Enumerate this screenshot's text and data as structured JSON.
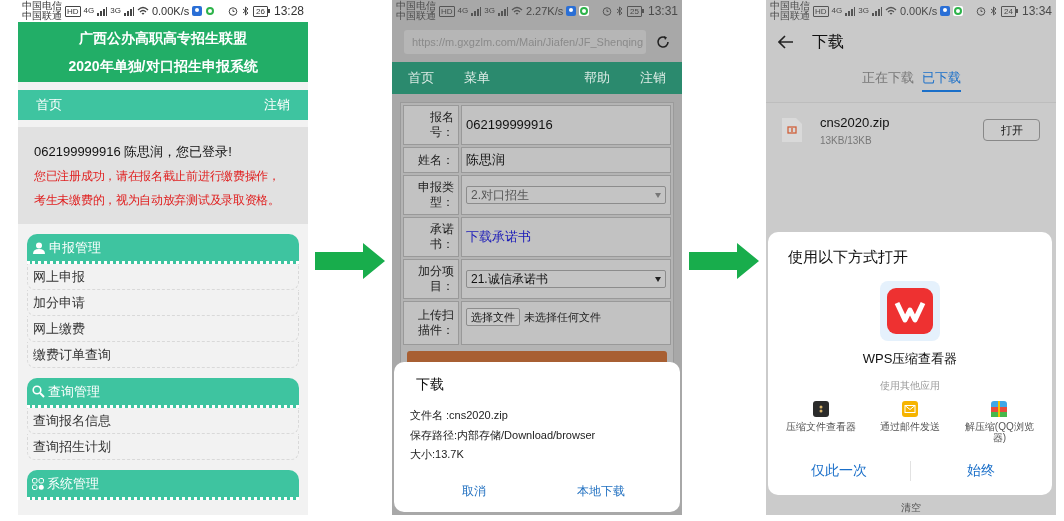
{
  "screen_1": {
    "status_bar": {
      "carrier_1": "中国电信",
      "carrier_2": "中国联通",
      "hd": "HD",
      "network_1": "4G",
      "network_2": "3G",
      "speed": "0.00K/s",
      "battery": "26",
      "time": "13:28"
    },
    "header": [
      "广西公办高职高专招生联盟",
      "2020年单独/对口招生申报系统"
    ],
    "nav": [
      "首页",
      "注销"
    ],
    "login": "062199999916 陈思润，您已登录!",
    "warning": [
      "您已注册成功，请在报名截止前进行缴费操作，",
      "考生未缴费的，视为自动放弃测试及录取资格。"
    ],
    "sections": [
      {
        "title": "申报管理",
        "items": [
          "网上申报",
          "加分申请",
          "网上缴费",
          "缴费订单查询"
        ]
      },
      {
        "title": "查询管理",
        "items": [
          "查询报名信息",
          "查询招生计划"
        ]
      },
      {
        "title": "系统管理"
      }
    ]
  },
  "screen_2": {
    "status_bar": {
      "carrier_1": "中国电信",
      "carrier_2": "中国联通",
      "hd": "HD",
      "network_1": "4G",
      "network_2": "3G",
      "speed": "2.27K/s",
      "battery": "25",
      "time": "13:31"
    },
    "url": "https://m.gxgzlm.com/Main/Jiafen/JF_Shenqing",
    "nav": [
      "首页",
      "菜单",
      "帮助",
      "注销"
    ],
    "form": [
      {
        "kind": "text",
        "label": "报名号：",
        "value": "062199999916"
      },
      {
        "kind": "text",
        "label": "姓名：",
        "value": "陈思润"
      },
      {
        "kind": "select",
        "label": "申报类型：",
        "value": "2.对口招生",
        "disabled": true
      },
      {
        "kind": "link",
        "label": "承诺书：",
        "value": "下载承诺书"
      },
      {
        "kind": "select",
        "label": "加分项目：",
        "value": "21.诚信承诺书",
        "disabled": false
      },
      {
        "kind": "file",
        "label": "上传扫描件：",
        "button": "选择文件",
        "value": "未选择任何文件"
      }
    ],
    "dialog": {
      "title": "下载",
      "lines": [
        "文件名 :cns2020.zip",
        "保存路径:内部存储/Download/browser",
        "大小:13.7K"
      ],
      "buttons": [
        "取消",
        "本地下载"
      ]
    }
  },
  "screen_3": {
    "status_bar": {
      "carrier_1": "中国电信",
      "carrier_2": "中国联通",
      "hd": "HD",
      "network_1": "4G",
      "network_2": "3G",
      "speed": "0.00K/s",
      "battery": "24",
      "time": "13:34"
    },
    "title": "下载",
    "tabs": [
      {
        "label": "正在下载",
        "selected": false
      },
      {
        "label": "已下载",
        "selected": true
      }
    ],
    "file": {
      "name": "cns2020.zip",
      "size": "13KB/13KB",
      "button": "打开"
    },
    "dialog": {
      "title": "使用以下方式打开",
      "app": "WPS压缩查看器",
      "other_label": "使用其他应用",
      "other_apps": [
        "压缩文件查看器",
        "通过邮件发送",
        "解压缩(QQ浏览器)"
      ],
      "buttons": [
        "仅此一次",
        "始终"
      ]
    },
    "bottom_action": "清空"
  }
}
